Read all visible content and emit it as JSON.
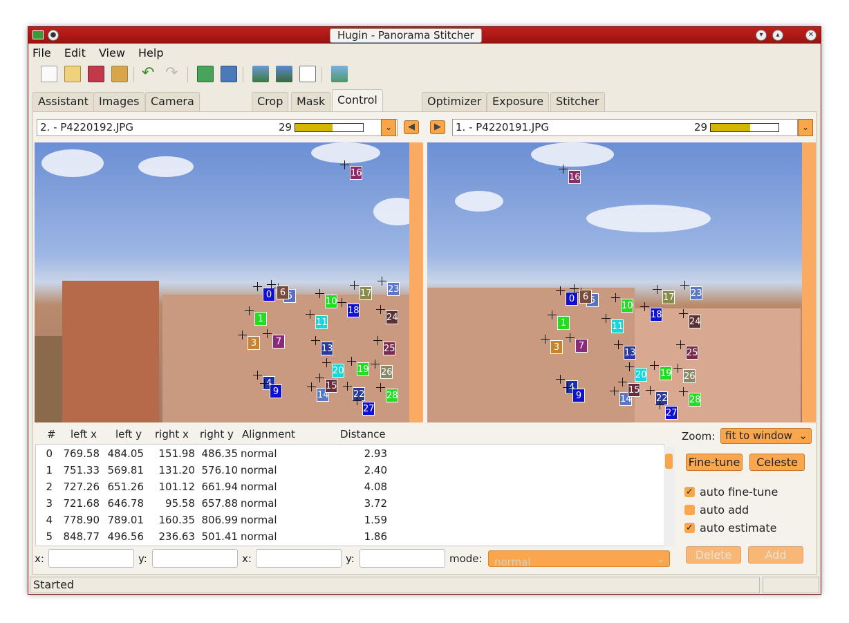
{
  "window": {
    "title": "Hugin - Panorama Stitcher"
  },
  "menu": [
    "File",
    "Edit",
    "View",
    "Help"
  ],
  "tabs": [
    "Assistant",
    "Images",
    "Camera and Lens",
    "Crop",
    "Mask",
    "Control Points",
    "Optimizer",
    "Exposure",
    "Stitcher"
  ],
  "active_tab": "Control Points",
  "left_image": {
    "label": "2. - P4220192.JPG",
    "count": "29",
    "quality": 0.55
  },
  "right_image": {
    "label": "1. - P4220191.JPG",
    "count": "29",
    "quality": 0.58
  },
  "table": {
    "headers": [
      "#",
      "left x",
      "left y",
      "right x",
      "right y",
      "Alignment",
      "Distance"
    ],
    "rows": [
      [
        "0",
        "769.58",
        "484.05",
        "151.98",
        "486.35",
        "normal",
        "2.93"
      ],
      [
        "1",
        "751.33",
        "569.81",
        "131.20",
        "576.10",
        "normal",
        "2.40"
      ],
      [
        "2",
        "727.26",
        "651.26",
        "101.12",
        "661.94",
        "normal",
        "4.08"
      ],
      [
        "3",
        "721.68",
        "646.78",
        "95.58",
        "657.88",
        "normal",
        "3.72"
      ],
      [
        "4",
        "778.90",
        "789.01",
        "160.35",
        "806.99",
        "normal",
        "1.59"
      ],
      [
        "5",
        "848.77",
        "496.56",
        "236.63",
        "501.41",
        "normal",
        "1.86"
      ]
    ]
  },
  "zoom": {
    "label": "Zoom:",
    "value": "fit to window"
  },
  "buttons": {
    "finetune": "Fine-tune",
    "celeste": "Celeste",
    "delete": "Delete",
    "add": "Add"
  },
  "options": [
    {
      "label": "auto fine-tune",
      "checked": true
    },
    {
      "label": "auto add",
      "checked": false
    },
    {
      "label": "auto estimate",
      "checked": true
    }
  ],
  "coords": {
    "x": "x:",
    "y": "y:",
    "mode_label": "mode:",
    "mode_value": "normal"
  },
  "status": "Started",
  "colors": {
    "accent": "#f9a64c",
    "titlebar": "#b01a16"
  }
}
